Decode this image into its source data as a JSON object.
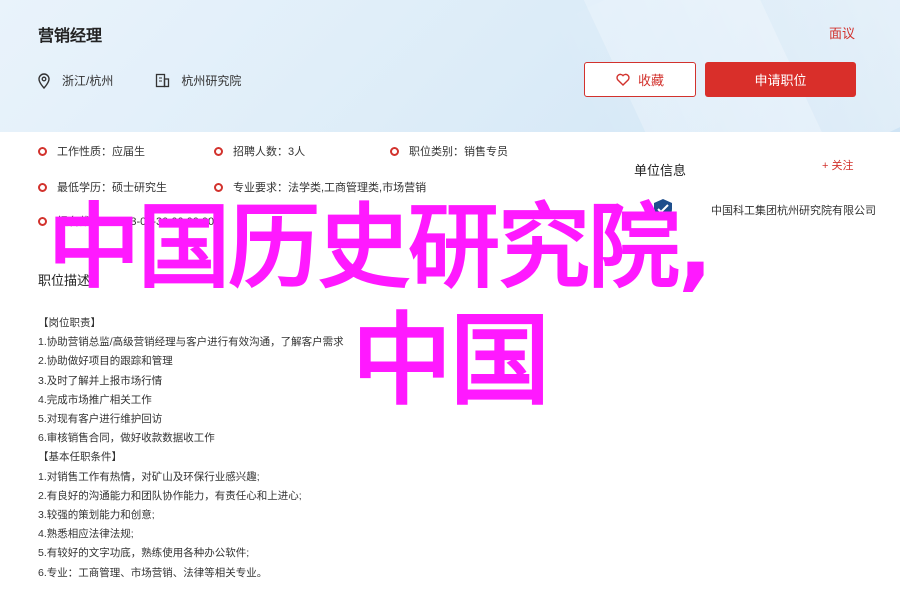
{
  "header": {
    "job_title": "营销经理",
    "back_label": "面议",
    "location": "浙江/杭州",
    "company": "杭州研究院",
    "favorite_label": "收藏",
    "apply_label": "申请职位"
  },
  "attributes": {
    "job_nature": "工作性质：应届生",
    "headcount": "招聘人数：3人",
    "category": "职位类别：销售专员",
    "education": "最低学历：硕士研究生",
    "major": "专业要求：法学类,工商管理类,市场营销",
    "deadline": "报名截止：2023-06-30 00:00:00"
  },
  "sidebar": {
    "title": "单位信息",
    "follow_label": "+ 关注",
    "company_name": "中国科工集团杭州研究院有限公司"
  },
  "description": {
    "heading": "职位描述",
    "lines": [
      "【岗位职责】",
      "1.协助营销总监/高级营销经理与客户进行有效沟通，了解客户需求",
      "2.协助做好项目的跟踪和管理",
      "3.及时了解并上报市场行情",
      "4.完成市场推广相关工作",
      "5.对现有客户进行维护回访",
      "6.审核销售合同，做好收款数据收工作",
      "【基本任职条件】",
      "1.对销售工作有热情，对矿山及环保行业感兴趣;",
      "2.有良好的沟通能力和团队协作能力，有责任心和上进心;",
      "3.较强的策划能力和创意;",
      "4.熟悉相应法律法规;",
      "5.有较好的文字功底，熟练使用各种办公软件;",
      "6.专业：工商管理、市场营销、法律等相关专业。"
    ]
  },
  "overlay": {
    "line1": "中国历史研究院,",
    "line2": "中国"
  },
  "colors": {
    "accent": "#d92f2a",
    "overlay": "#ff19ff",
    "header_bg": "#dcecf8"
  }
}
